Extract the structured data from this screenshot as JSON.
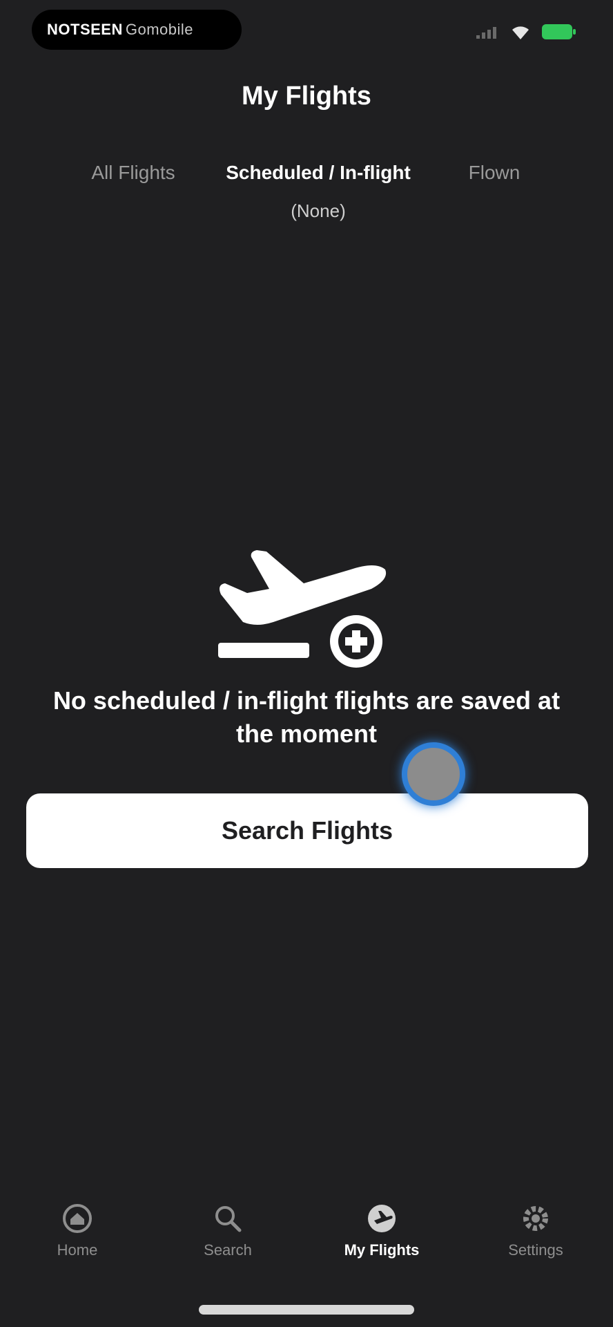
{
  "status_bar": {
    "pill_text_strong": "NOTSEEN",
    "pill_text_weak": "Gomobile"
  },
  "header": {
    "title": "My Flights"
  },
  "tabs": [
    {
      "label": "All Flights"
    },
    {
      "label_line1": "Scheduled / In-flight",
      "label_line2": "(None)"
    },
    {
      "label": "Flown"
    }
  ],
  "empty_state": {
    "icon": "airplane-takeoff-plus-icon",
    "message": "No scheduled / in-flight flights are saved at the moment"
  },
  "actions": {
    "search_button_label": "Search Flights"
  },
  "bottom_nav": {
    "items": [
      {
        "label": "Home",
        "icon": "home-icon"
      },
      {
        "label": "Search",
        "icon": "search-icon"
      },
      {
        "label": "My Flights",
        "icon": "my-flights-icon",
        "active": true
      },
      {
        "label": "Settings",
        "icon": "settings-icon"
      }
    ]
  },
  "colors": {
    "background": "#1f1f21",
    "accent_touch": "#2f7fd6",
    "battery": "#32c75a"
  }
}
